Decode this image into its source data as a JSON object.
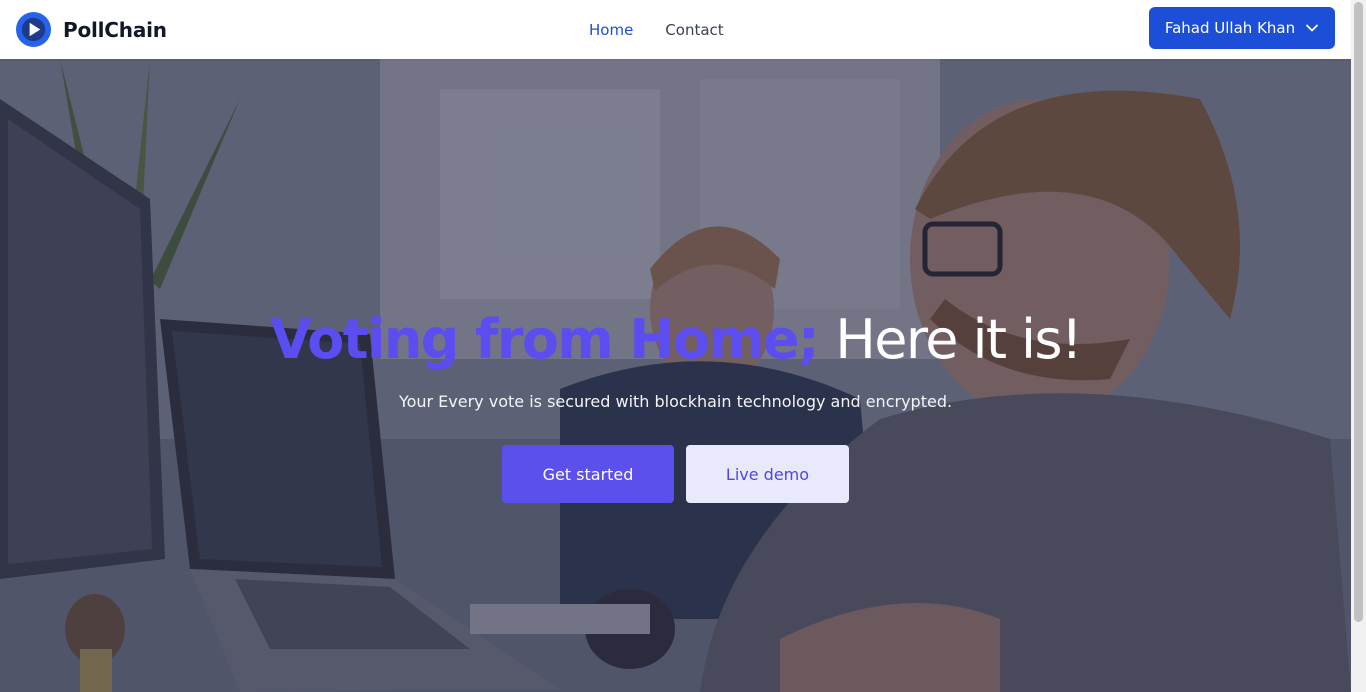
{
  "header": {
    "brand_name": "PollChain",
    "logo_icon": "play-circle-icon",
    "nav_links": [
      {
        "label": "Home",
        "active": true
      },
      {
        "label": "Contact",
        "active": false
      }
    ],
    "user_button_label": "Fahad Ullah Khan",
    "user_button_icon": "chevron-down-icon"
  },
  "hero": {
    "title_accent": "Voting from Home;",
    "title_plain": "Here it is!",
    "subtitle": "Your Every vote is secured with blockhain technology and encrypted.",
    "primary_button": "Get started",
    "secondary_button": "Live demo"
  },
  "colors": {
    "brand_blue": "#1d4ed8",
    "accent_indigo": "#5b4df0",
    "secondary_btn_bg": "#e8eafc"
  }
}
